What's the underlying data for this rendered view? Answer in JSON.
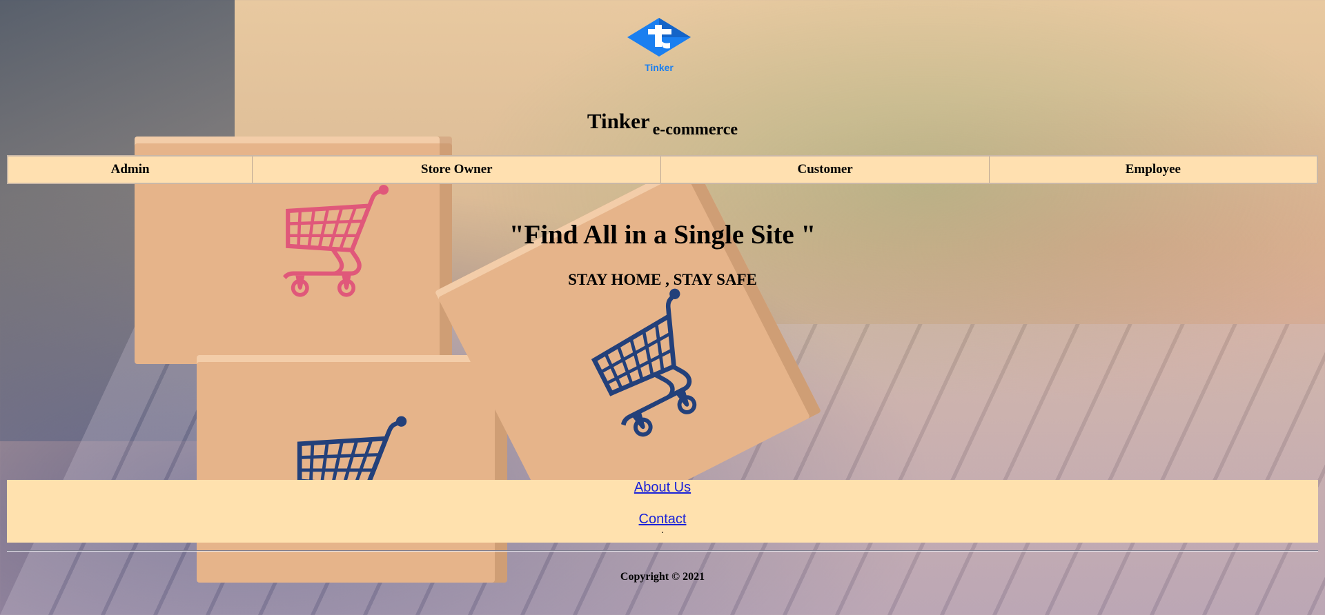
{
  "logo": {
    "text": "Tinker",
    "color": "#1a7ff0"
  },
  "brand": {
    "main": "Tinker",
    "sub": "e-commerce"
  },
  "nav": [
    "Admin",
    "Store Owner",
    "Customer",
    "Employee"
  ],
  "hero": {
    "tagline": "\"Find All in a Single Site \"",
    "subtitle": "STAY HOME , STAY SAFE"
  },
  "footer": {
    "about": "About Us",
    "contact": "Contact",
    "dot": ".",
    "copyright": "Copyright © 2021"
  },
  "colors": {
    "nav_bg": "#ffe0b0",
    "footer_bg": "#ffe1ae",
    "link": "#1a22d8"
  }
}
